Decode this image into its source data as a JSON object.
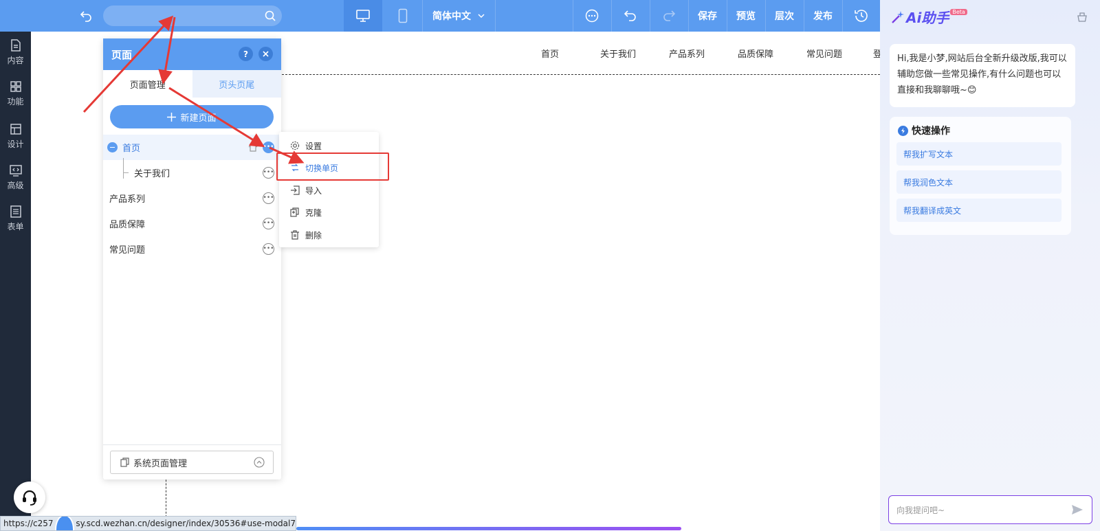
{
  "topbar": {
    "language": "简体中文",
    "save": "保存",
    "preview": "预览",
    "layers": "层次",
    "publish": "发布"
  },
  "sidebar": {
    "items": [
      {
        "label": "内容",
        "icon": "document-icon"
      },
      {
        "label": "功能",
        "icon": "grid-icon"
      },
      {
        "label": "设计",
        "icon": "layout-icon"
      },
      {
        "label": "高级",
        "icon": "code-icon"
      },
      {
        "label": "表单",
        "icon": "list-icon"
      }
    ]
  },
  "site_nav": [
    "首页",
    "关于我们",
    "产品系列",
    "品质保障",
    "常见问题",
    "登"
  ],
  "pages_panel": {
    "title": "页面",
    "help": "?",
    "tabs": [
      "页面管理",
      "页头页尾"
    ],
    "new_page": "新建页面",
    "pages": [
      {
        "label": "首页",
        "active": true
      },
      {
        "label": "关于我们",
        "child": true
      },
      {
        "label": "产品系列"
      },
      {
        "label": "品质保障"
      },
      {
        "label": "常见问题"
      }
    ],
    "system_pages": "系统页面管理"
  },
  "context_menu": {
    "items": [
      {
        "label": "设置",
        "icon": "gear-icon"
      },
      {
        "label": "切换单页",
        "icon": "switch-icon",
        "highlighted": true
      },
      {
        "label": "导入",
        "icon": "import-icon"
      },
      {
        "label": "克隆",
        "icon": "clone-icon"
      },
      {
        "label": "删除",
        "icon": "trash-icon"
      }
    ]
  },
  "ai_assistant": {
    "title": "Ai助手",
    "badge": "Beta",
    "greeting": "Hi,我是小梦,网站后台全新升级改版,我可以辅助您做一些常见操作,有什么问题也可以直接和我聊聊哦~",
    "emoji": "😊",
    "quick_title": "快速操作",
    "quick_actions": [
      "帮我扩写文本",
      "帮我润色文本",
      "帮我翻译成英文"
    ],
    "input_placeholder": "向我提问吧~"
  },
  "status_bar": {
    "url_prefix": "https://c257",
    "url_suffix": "sy.scd.wezhan.cn/designer/index/30536#use-modal7"
  },
  "colors": {
    "topbar": "#5b9cf0",
    "sidebar": "#202a3a",
    "accent": "#5b9cf0",
    "annotation": "#e53935"
  }
}
